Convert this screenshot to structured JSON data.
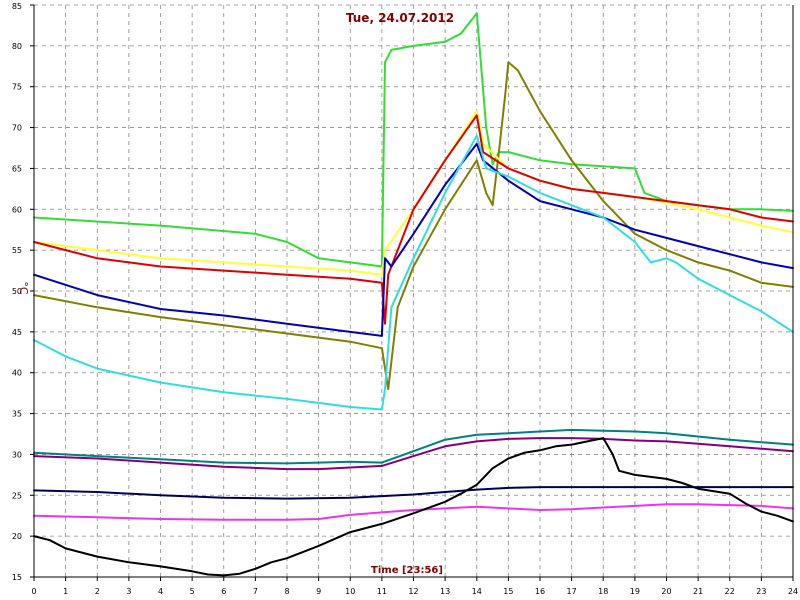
{
  "chart_data": {
    "type": "line",
    "title": "Tue, 24.07.2012",
    "xlabel": "Time [23:56]",
    "ylabel": "°C",
    "xlim": [
      0,
      24
    ],
    "ylim": [
      15,
      85
    ],
    "x_ticks": [
      "0",
      "1",
      "2",
      "3",
      "4",
      "5",
      "6",
      "7",
      "8",
      "9",
      "10",
      "11",
      "12",
      "13",
      "14",
      "15",
      "16",
      "17",
      "18",
      "19",
      "20",
      "21",
      "22",
      "23",
      "24"
    ],
    "y_ticks": [
      "15",
      "20",
      "25",
      "30",
      "35",
      "40",
      "45",
      "50",
      "55",
      "60",
      "65",
      "70",
      "75",
      "80",
      "85"
    ],
    "grid": true,
    "series": [
      {
        "color": "#33dd33",
        "points": [
          [
            0,
            59
          ],
          [
            4,
            58
          ],
          [
            7,
            57
          ],
          [
            8,
            56
          ],
          [
            8.5,
            55
          ],
          [
            9,
            54
          ],
          [
            10,
            53.5
          ],
          [
            11,
            53
          ],
          [
            11.1,
            78
          ],
          [
            11.3,
            79.5
          ],
          [
            12,
            80
          ],
          [
            13,
            80.5
          ],
          [
            13.5,
            81.5
          ],
          [
            14,
            84
          ],
          [
            14.3,
            70
          ],
          [
            14.5,
            65.5
          ],
          [
            14.7,
            67
          ],
          [
            15,
            67
          ],
          [
            16,
            66
          ],
          [
            17,
            65.5
          ],
          [
            19,
            65
          ],
          [
            19.3,
            62
          ],
          [
            20,
            61
          ],
          [
            21,
            60.5
          ],
          [
            22,
            60
          ],
          [
            23,
            60
          ],
          [
            24,
            59.8
          ]
        ]
      },
      {
        "color": "#808000",
        "points": [
          [
            0,
            49.5
          ],
          [
            2,
            48
          ],
          [
            4,
            46.8
          ],
          [
            6,
            45.8
          ],
          [
            8,
            44.8
          ],
          [
            10,
            43.8
          ],
          [
            11,
            43
          ],
          [
            11.2,
            38
          ],
          [
            11.5,
            48
          ],
          [
            12,
            53
          ],
          [
            13,
            60
          ],
          [
            14,
            66
          ],
          [
            14.3,
            62
          ],
          [
            14.5,
            60.5
          ],
          [
            14.7,
            67
          ],
          [
            14.9,
            74
          ],
          [
            15,
            78
          ],
          [
            15.3,
            77
          ],
          [
            16,
            72
          ],
          [
            17,
            66
          ],
          [
            18,
            61
          ],
          [
            19,
            57
          ],
          [
            20,
            55
          ],
          [
            21,
            53.5
          ],
          [
            22,
            52.5
          ],
          [
            23,
            51
          ],
          [
            24,
            50.5
          ]
        ]
      },
      {
        "color": "#ffff33",
        "points": [
          [
            0,
            56
          ],
          [
            2,
            55
          ],
          [
            4,
            54
          ],
          [
            6,
            53.5
          ],
          [
            8,
            53
          ],
          [
            10,
            52.5
          ],
          [
            11,
            52
          ],
          [
            11.1,
            55
          ],
          [
            12,
            60
          ],
          [
            13,
            66
          ],
          [
            14,
            72
          ],
          [
            14.2,
            68
          ],
          [
            15,
            65
          ],
          [
            16,
            63.5
          ],
          [
            17,
            62.5
          ],
          [
            18,
            62
          ],
          [
            19,
            61.5
          ],
          [
            20,
            60.8
          ],
          [
            21,
            60
          ],
          [
            22,
            59
          ],
          [
            23,
            58
          ],
          [
            24,
            57.2
          ]
        ]
      },
      {
        "color": "#dd0000",
        "points": [
          [
            0,
            56
          ],
          [
            1,
            55
          ],
          [
            2,
            54
          ],
          [
            4,
            53
          ],
          [
            6,
            52.5
          ],
          [
            8,
            52
          ],
          [
            10,
            51.5
          ],
          [
            11,
            51
          ],
          [
            11.1,
            46
          ],
          [
            11.2,
            52
          ],
          [
            11.5,
            55
          ],
          [
            12,
            60
          ],
          [
            13,
            66
          ],
          [
            14,
            71.5
          ],
          [
            14.2,
            67
          ],
          [
            15,
            65
          ],
          [
            16,
            63.5
          ],
          [
            17,
            62.5
          ],
          [
            18,
            62
          ],
          [
            19,
            61.5
          ],
          [
            20,
            61
          ],
          [
            21,
            60.5
          ],
          [
            22,
            60
          ],
          [
            23,
            59
          ],
          [
            24,
            58.5
          ]
        ]
      },
      {
        "color": "#0000bb",
        "points": [
          [
            0,
            52
          ],
          [
            2,
            49.5
          ],
          [
            4,
            47.8
          ],
          [
            6,
            47
          ],
          [
            8,
            46
          ],
          [
            10,
            45
          ],
          [
            11,
            44.5
          ],
          [
            11.1,
            54
          ],
          [
            11.3,
            53
          ],
          [
            12,
            57
          ],
          [
            13,
            63
          ],
          [
            14,
            68
          ],
          [
            14.2,
            66
          ],
          [
            15,
            63.5
          ],
          [
            16,
            61
          ],
          [
            17,
            60
          ],
          [
            18,
            59
          ],
          [
            19,
            57.5
          ],
          [
            20,
            56.5
          ],
          [
            21,
            55.5
          ],
          [
            22,
            54.5
          ],
          [
            23,
            53.5
          ],
          [
            24,
            52.8
          ]
        ]
      },
      {
        "color": "#33dddd",
        "points": [
          [
            0,
            44
          ],
          [
            1,
            42
          ],
          [
            2,
            40.5
          ],
          [
            4,
            38.8
          ],
          [
            6,
            37.6
          ],
          [
            8,
            36.8
          ],
          [
            9,
            36.3
          ],
          [
            10,
            35.8
          ],
          [
            11,
            35.5
          ],
          [
            11.1,
            38
          ],
          [
            11.3,
            48
          ],
          [
            12,
            54
          ],
          [
            13,
            62
          ],
          [
            14,
            69
          ],
          [
            14.3,
            65
          ],
          [
            15,
            64
          ],
          [
            16,
            62
          ],
          [
            17,
            60.5
          ],
          [
            18,
            59
          ],
          [
            19,
            56
          ],
          [
            19.5,
            53.5
          ],
          [
            20,
            54
          ],
          [
            20.3,
            53.5
          ],
          [
            21,
            51.5
          ],
          [
            22,
            49.5
          ],
          [
            23,
            47.5
          ],
          [
            24,
            45
          ]
        ]
      },
      {
        "color": "#008080",
        "points": [
          [
            0,
            30.2
          ],
          [
            2,
            29.8
          ],
          [
            4,
            29.4
          ],
          [
            6,
            29
          ],
          [
            8,
            28.9
          ],
          [
            9,
            29
          ],
          [
            10,
            29.1
          ],
          [
            11,
            29
          ],
          [
            12,
            30.4
          ],
          [
            13,
            31.8
          ],
          [
            14,
            32.4
          ],
          [
            15,
            32.6
          ],
          [
            16,
            32.8
          ],
          [
            17,
            33
          ],
          [
            18,
            32.9
          ],
          [
            19,
            32.8
          ],
          [
            20,
            32.6
          ],
          [
            21,
            32.2
          ],
          [
            22,
            31.8
          ],
          [
            23,
            31.5
          ],
          [
            24,
            31.2
          ]
        ]
      },
      {
        "color": "#800080",
        "points": [
          [
            0,
            29.8
          ],
          [
            2,
            29.5
          ],
          [
            4,
            29
          ],
          [
            6,
            28.5
          ],
          [
            8,
            28.2
          ],
          [
            9,
            28.2
          ],
          [
            10,
            28.4
          ],
          [
            11,
            28.6
          ],
          [
            12,
            29.8
          ],
          [
            13,
            31
          ],
          [
            14,
            31.6
          ],
          [
            15,
            31.9
          ],
          [
            16,
            32
          ],
          [
            17,
            32
          ],
          [
            18,
            31.9
          ],
          [
            19,
            31.7
          ],
          [
            20,
            31.6
          ],
          [
            21,
            31.3
          ],
          [
            22,
            31
          ],
          [
            23,
            30.7
          ],
          [
            24,
            30.4
          ]
        ]
      },
      {
        "color": "#000055",
        "points": [
          [
            0,
            25.6
          ],
          [
            2,
            25.4
          ],
          [
            4,
            25
          ],
          [
            6,
            24.7
          ],
          [
            8,
            24.6
          ],
          [
            10,
            24.7
          ],
          [
            11,
            24.9
          ],
          [
            12,
            25.1
          ],
          [
            13,
            25.4
          ],
          [
            14,
            25.7
          ],
          [
            15,
            25.9
          ],
          [
            16,
            26
          ],
          [
            17,
            26
          ],
          [
            18,
            26
          ],
          [
            19,
            26
          ],
          [
            20,
            26
          ],
          [
            21,
            26
          ],
          [
            22,
            26
          ],
          [
            23,
            26
          ],
          [
            24,
            26
          ]
        ]
      },
      {
        "color": "#ee33ee",
        "points": [
          [
            0,
            22.5
          ],
          [
            2,
            22.3
          ],
          [
            4,
            22.1
          ],
          [
            6,
            22
          ],
          [
            8,
            22
          ],
          [
            9,
            22.1
          ],
          [
            10,
            22.6
          ],
          [
            11,
            22.9
          ],
          [
            12,
            23.2
          ],
          [
            13,
            23.4
          ],
          [
            14,
            23.6
          ],
          [
            15,
            23.4
          ],
          [
            16,
            23.2
          ],
          [
            17,
            23.3
          ],
          [
            18,
            23.5
          ],
          [
            19,
            23.7
          ],
          [
            20,
            23.9
          ],
          [
            21,
            23.9
          ],
          [
            22,
            23.8
          ],
          [
            23,
            23.7
          ],
          [
            24,
            23.4
          ]
        ]
      },
      {
        "color": "#000000",
        "points": [
          [
            0,
            20
          ],
          [
            0.5,
            19.5
          ],
          [
            1,
            18.5
          ],
          [
            2,
            17.5
          ],
          [
            3,
            16.8
          ],
          [
            4,
            16.3
          ],
          [
            5,
            15.7
          ],
          [
            5.5,
            15.3
          ],
          [
            6,
            15.2
          ],
          [
            6.5,
            15.4
          ],
          [
            7,
            16
          ],
          [
            7.5,
            16.8
          ],
          [
            8,
            17.3
          ],
          [
            9,
            18.8
          ],
          [
            10,
            20.5
          ],
          [
            11,
            21.5
          ],
          [
            12,
            22.8
          ],
          [
            13,
            24.2
          ],
          [
            13.5,
            25.2
          ],
          [
            14,
            26.3
          ],
          [
            14.5,
            28.3
          ],
          [
            15,
            29.5
          ],
          [
            15.5,
            30.2
          ],
          [
            16,
            30.5
          ],
          [
            16.5,
            31
          ],
          [
            17,
            31.2
          ],
          [
            17.5,
            31.6
          ],
          [
            18,
            32
          ],
          [
            18.3,
            30
          ],
          [
            18.5,
            28
          ],
          [
            19,
            27.5
          ],
          [
            20,
            27
          ],
          [
            20.5,
            26.5
          ],
          [
            21,
            25.8
          ],
          [
            22,
            25.2
          ],
          [
            22.5,
            24
          ],
          [
            23,
            23
          ],
          [
            23.5,
            22.5
          ],
          [
            24,
            21.8
          ]
        ]
      }
    ]
  }
}
